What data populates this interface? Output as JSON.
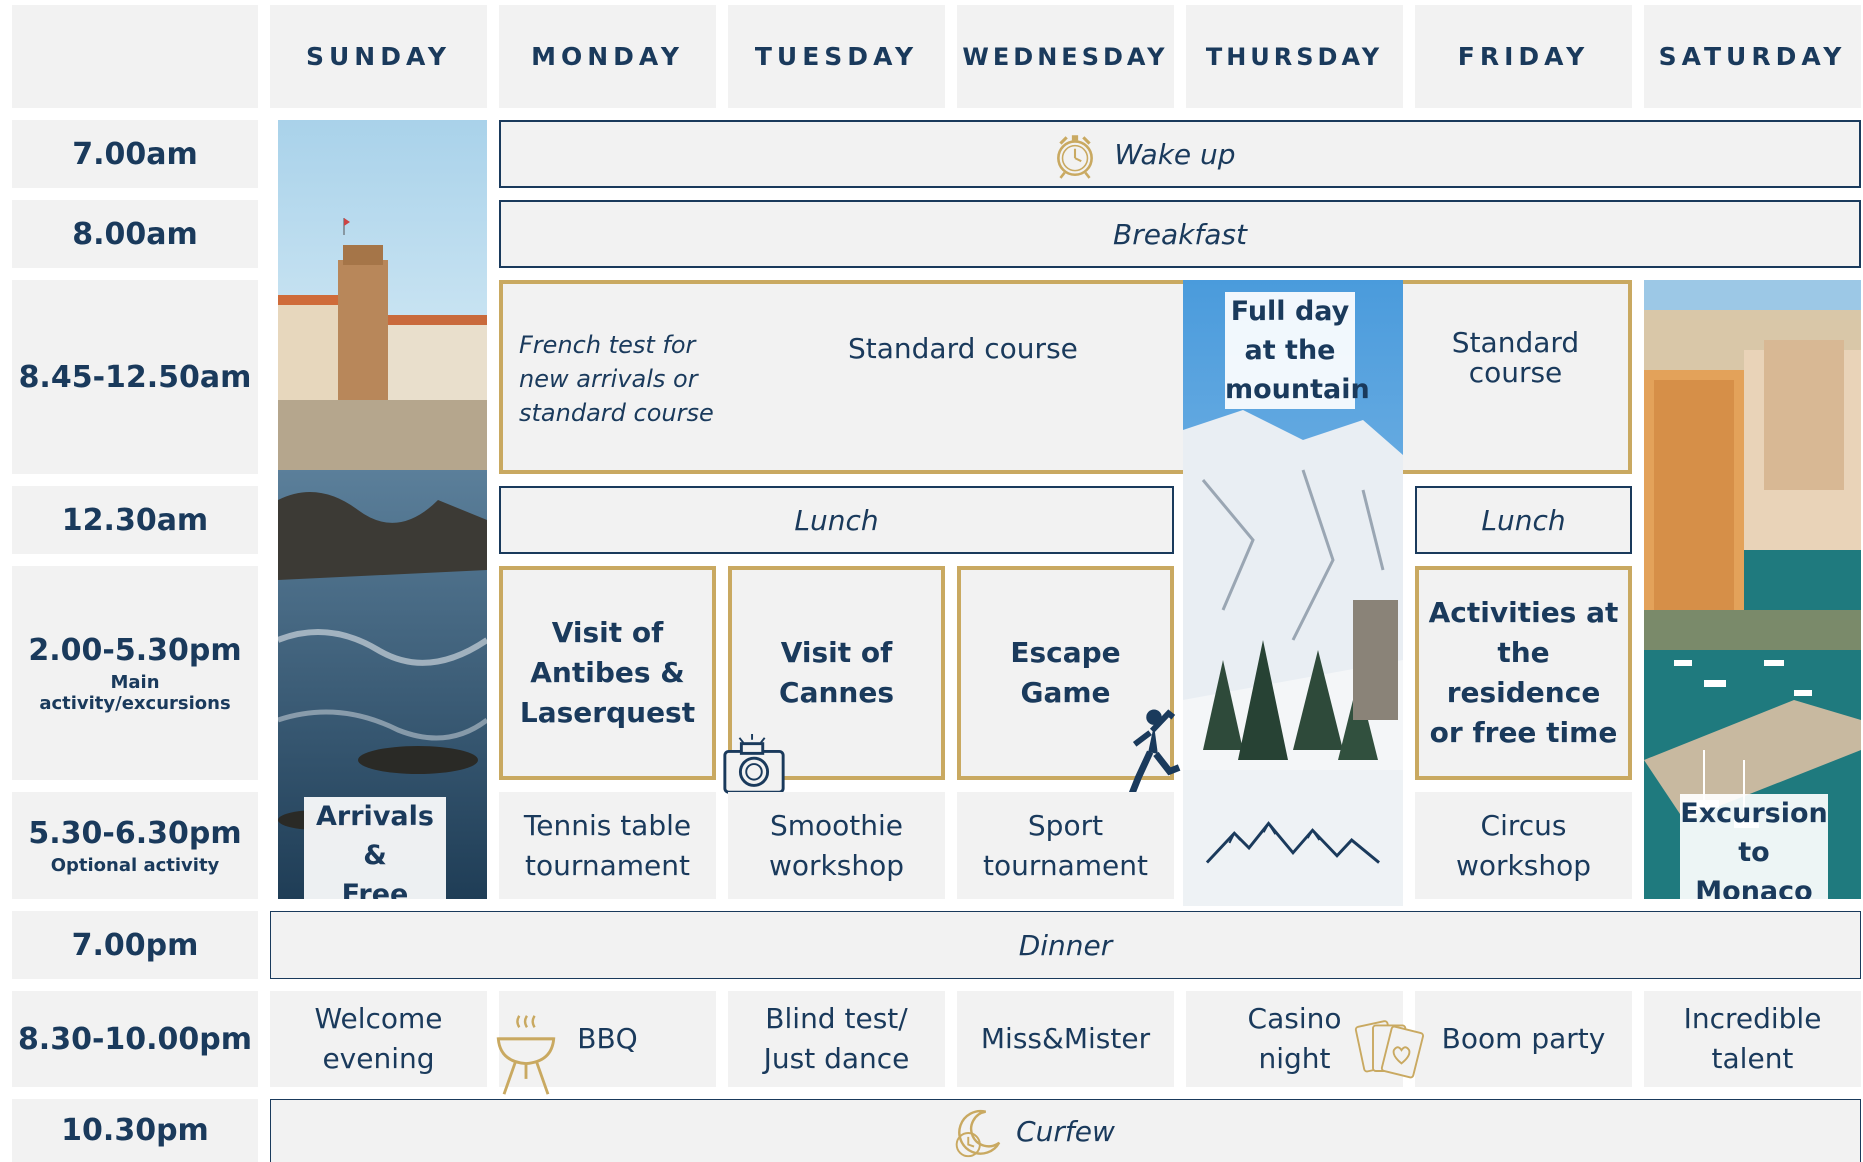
{
  "days": [
    "SUNDAY",
    "MONDAY",
    "TUESDAY",
    "WEDNESDAY",
    "THURSDAY",
    "FRIDAY",
    "SATURDAY"
  ],
  "times": {
    "t0700": {
      "label": "7.00am"
    },
    "t0800": {
      "label": "8.00am"
    },
    "t0845": {
      "label": "8.45-12.50am"
    },
    "t1230": {
      "label": "12.30am"
    },
    "t1400": {
      "label": "2.00-5.30pm",
      "sub": "Main activity/excursions"
    },
    "t1730": {
      "label": "5.30-6.30pm",
      "sub": "Optional activity"
    },
    "t1900": {
      "label": "7.00pm"
    },
    "t2030": {
      "label": "8.30-10.00pm"
    },
    "t2230": {
      "label": "10.30pm"
    }
  },
  "rows": {
    "wake_up": "Wake up",
    "breakfast": "Breakfast",
    "dinner": "Dinner",
    "curfew": "Curfew"
  },
  "morning": {
    "monday_italic": [
      "French test for",
      "new arrivals or",
      "standard course"
    ],
    "standard_course": "Standard course",
    "friday": [
      "Standard",
      "course"
    ]
  },
  "lunch": {
    "mon_wed": "Lunch",
    "friday": "Lunch"
  },
  "photos": {
    "sunday": [
      "Arrivals &",
      "Free time"
    ],
    "thursday": [
      "Full day",
      "at the",
      "mountain"
    ],
    "saturday": [
      "Excursion",
      "to Monaco"
    ]
  },
  "afternoon": {
    "monday": [
      "Visit of",
      "Antibes  &",
      "Laserquest"
    ],
    "tuesday": [
      "Visit of",
      "Cannes"
    ],
    "wednesday": [
      "Escape",
      "Game"
    ],
    "friday": [
      "Activities at",
      "the residence",
      "or free time"
    ]
  },
  "optional": {
    "monday": [
      "Tennis table",
      "tournament"
    ],
    "tuesday": [
      "Smoothie",
      "workshop"
    ],
    "wednesday": [
      "Sport",
      "tournament"
    ],
    "friday": [
      "Circus",
      "workshop"
    ]
  },
  "evening": {
    "sunday": [
      "Welcome",
      "evening"
    ],
    "monday": "BBQ",
    "tuesday": [
      "Blind test/",
      "Just dance"
    ],
    "wednesday": "Miss&Mister",
    "thursday": [
      "Casino",
      "night"
    ],
    "friday": "Boom party",
    "saturday": [
      "Incredible",
      "talent"
    ]
  },
  "colors": {
    "navy": "#1a3a5c",
    "gold": "#c9a961",
    "cell_bg": "#f2f2f2"
  }
}
